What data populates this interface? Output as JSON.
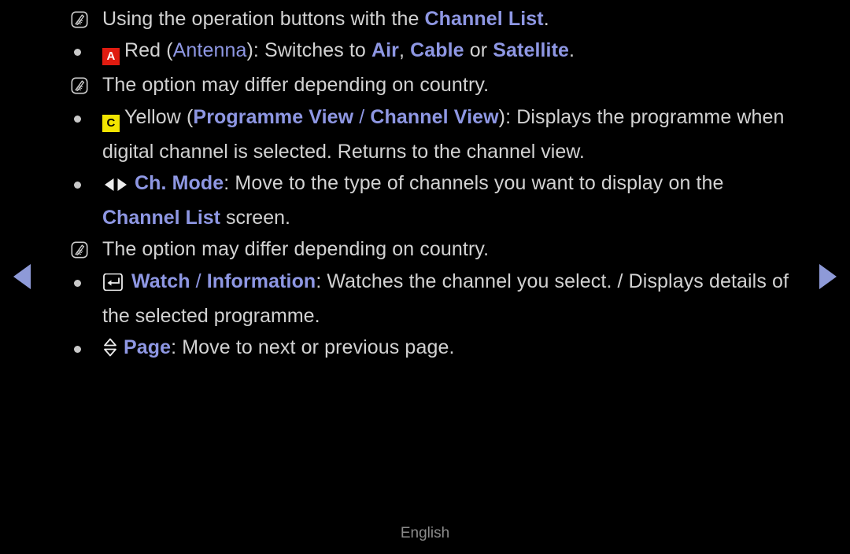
{
  "screen": {
    "background_color": "#000000",
    "accent_color": "#8e97e3",
    "text_color": "#d2d2d2"
  },
  "nav": {
    "prev_label": "Previous page",
    "next_label": "Next page",
    "arrow_color": "#8e9ad8"
  },
  "footer": {
    "language": "English"
  },
  "content": {
    "blocks": [
      {
        "kind": "note",
        "icon": "note-icon",
        "text_pre": "Using the operation buttons with the ",
        "accent": "Channel List",
        "text_post": "."
      },
      {
        "kind": "bullet",
        "badge": {
          "label": "A",
          "bg": "#e01b10",
          "fg": "#ffffff"
        },
        "segments": [
          {
            "t": "Red (",
            "style": "plain"
          },
          {
            "t": "Antenna",
            "style": "accent-plain"
          },
          {
            "t": "): Switches to ",
            "style": "plain"
          },
          {
            "t": "Air",
            "style": "accent"
          },
          {
            "t": ", ",
            "style": "plain"
          },
          {
            "t": "Cable",
            "style": "accent"
          },
          {
            "t": " or ",
            "style": "plain"
          },
          {
            "t": "Satellite",
            "style": "accent"
          },
          {
            "t": ".",
            "style": "plain"
          }
        ]
      },
      {
        "kind": "note",
        "icon": "note-icon",
        "text_pre": "The option may differ depending on country.",
        "accent": "",
        "text_post": ""
      },
      {
        "kind": "bullet",
        "badge": {
          "label": "C",
          "bg": "#f2e500",
          "fg": "#000000"
        },
        "segments": [
          {
            "t": "Yellow (",
            "style": "plain"
          },
          {
            "t": "Programme View",
            "style": "accent"
          },
          {
            "t": " / ",
            "style": "accent-plain"
          },
          {
            "t": "Channel View",
            "style": "accent"
          },
          {
            "t": "): Displays the programme when",
            "style": "plain"
          }
        ],
        "continuation": "digital channel is selected. Returns to the channel view."
      },
      {
        "kind": "bullet",
        "icon": "left-right-arrows-icon",
        "segments": [
          {
            "t": "Ch. Mode",
            "style": "accent"
          },
          {
            "t": ": Move to the type of channels you want to display on the",
            "style": "plain"
          }
        ],
        "continuation_segments": [
          {
            "t": "Channel List",
            "style": "accent"
          },
          {
            "t": " screen.",
            "style": "plain"
          }
        ]
      },
      {
        "kind": "note",
        "icon": "note-icon",
        "text_pre": "The option may differ depending on country.",
        "accent": "",
        "text_post": ""
      },
      {
        "kind": "bullet",
        "icon": "enter-key-icon",
        "segments": [
          {
            "t": "Watch",
            "style": "accent"
          },
          {
            "t": " / ",
            "style": "accent-plain"
          },
          {
            "t": "Information",
            "style": "accent"
          },
          {
            "t": ": Watches the channel you select. / Displays details of",
            "style": "plain"
          }
        ],
        "continuation": "the selected programme."
      },
      {
        "kind": "bullet",
        "icon": "up-down-arrows-icon",
        "segments": [
          {
            "t": "Page",
            "style": "accent"
          },
          {
            "t": ": Move to next or previous page.",
            "style": "plain"
          }
        ]
      }
    ]
  }
}
